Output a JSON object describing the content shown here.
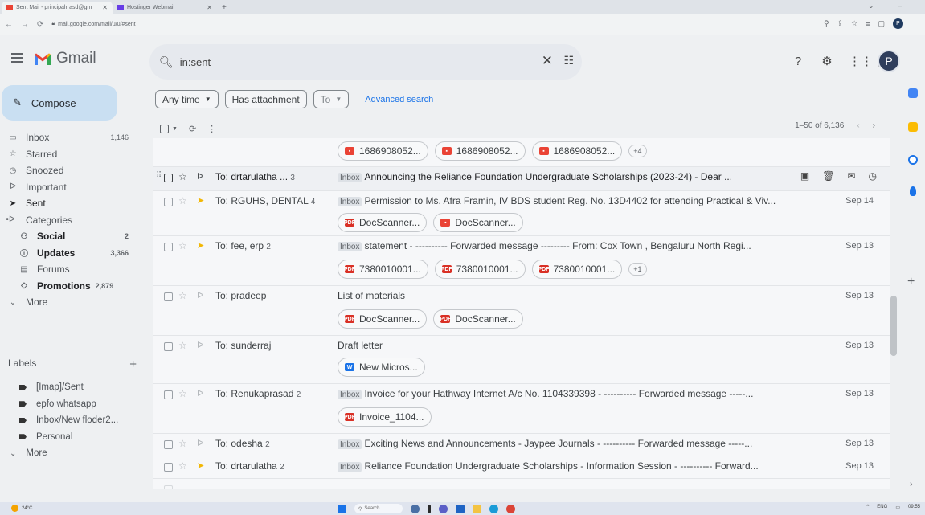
{
  "browser": {
    "tabs": [
      {
        "title": "Sent Mail - principalrrasd@gm",
        "active": true
      },
      {
        "title": "Hostinger Webmail",
        "active": false
      }
    ],
    "url": "mail.google.com/mail/u/0/#sent",
    "profile_initial": "P"
  },
  "header": {
    "logo_text": "Gmail",
    "search_value": "in:sent",
    "avatar_initial": "P"
  },
  "sidebar": {
    "compose_label": "Compose",
    "items": [
      {
        "icon": "inbox-icon",
        "label": "Inbox",
        "count": "1,146"
      },
      {
        "icon": "star-icon",
        "label": "Starred",
        "count": ""
      },
      {
        "icon": "clock-icon",
        "label": "Snoozed",
        "count": ""
      },
      {
        "icon": "important-icon",
        "label": "Important",
        "count": ""
      },
      {
        "icon": "send-icon",
        "label": "Sent",
        "count": ""
      },
      {
        "icon": "category-icon",
        "label": "Categories",
        "count": ""
      },
      {
        "icon": "social-icon",
        "label": "Social",
        "count": "2"
      },
      {
        "icon": "info-icon",
        "label": "Updates",
        "count": "3,366"
      },
      {
        "icon": "forum-icon",
        "label": "Forums",
        "count": ""
      },
      {
        "icon": "tag-icon",
        "label": "Promotions",
        "count": "2,879"
      },
      {
        "icon": "chevron-down-icon",
        "label": "More",
        "count": ""
      }
    ],
    "labels_title": "Labels",
    "labels": [
      "[Imap]/Sent",
      "epfo whatsapp",
      "Inbox/New floder2...",
      "Personal"
    ],
    "labels_more": "More"
  },
  "filters": {
    "any_time": "Any time",
    "has_attachment": "Has attachment",
    "to": "To",
    "advanced": "Advanced search"
  },
  "toolbar": {
    "pager": "1–50 of 6,136"
  },
  "emails": [
    {
      "from": "",
      "count": "",
      "inbox_tag": "",
      "subject": "",
      "date": "",
      "attachments": [
        {
          "type": "img",
          "name": "1686908052..."
        },
        {
          "type": "img",
          "name": "1686908052..."
        },
        {
          "type": "img",
          "name": "1686908052..."
        }
      ],
      "more": "+4"
    },
    {
      "from": "To: drtarulatha ...",
      "count": "3",
      "inbox_tag": "Inbox",
      "subject": "Announcing the Reliance Foundation Undergraduate Scholarships (2023-24) - Dear ...",
      "date": "",
      "attachments": []
    },
    {
      "from": "To: RGUHS, DENTAL",
      "count": "4",
      "inbox_tag": "Inbox",
      "subject": "Permission to Ms. Afra Framin, IV BDS student Reg. No. 13D4402 for attending Practical & Viv...",
      "date": "Sep 14",
      "attachments": [
        {
          "type": "pdf",
          "name": "DocScanner..."
        },
        {
          "type": "img",
          "name": "DocScanner..."
        }
      ]
    },
    {
      "from": "To: fee, erp",
      "count": "2",
      "inbox_tag": "Inbox",
      "subject": "statement - ---------- Forwarded message --------- From: Cox Town , Bengaluru North Regi...",
      "date": "Sep 13",
      "attachments": [
        {
          "type": "pdf",
          "name": "7380010001..."
        },
        {
          "type": "pdf",
          "name": "7380010001..."
        },
        {
          "type": "pdf",
          "name": "7380010001..."
        }
      ],
      "more": "+1"
    },
    {
      "from": "To: pradeep",
      "count": "",
      "inbox_tag": "",
      "subject": "List of materials",
      "date": "Sep 13",
      "attachments": [
        {
          "type": "pdf",
          "name": "DocScanner..."
        },
        {
          "type": "pdf",
          "name": "DocScanner..."
        }
      ]
    },
    {
      "from": "To: sunderraj",
      "count": "",
      "inbox_tag": "",
      "subject": "Draft letter",
      "date": "Sep 13",
      "attachments": [
        {
          "type": "doc",
          "name": "New Micros..."
        }
      ]
    },
    {
      "from": "To: Renukaprasad",
      "count": "2",
      "inbox_tag": "Inbox",
      "subject": "Invoice for your Hathway Internet A/c No. 1104339398 - ---------- Forwarded message -----...",
      "date": "Sep 13",
      "attachments": [
        {
          "type": "pdf",
          "name": "Invoice_1104..."
        }
      ]
    },
    {
      "from": "To: odesha",
      "count": "2",
      "inbox_tag": "Inbox",
      "subject": "Exciting News and Announcements - Jaypee Journals - ---------- Forwarded message -----...",
      "date": "Sep 13",
      "attachments": []
    },
    {
      "from": "To: drtarulatha",
      "count": "2",
      "inbox_tag": "Inbox",
      "subject": "Reliance Foundation Undergraduate Scholarships - Information Session - ---------- Forward...",
      "date": "Sep 13",
      "attachments": []
    }
  ],
  "taskbar": {
    "weather": "24°C",
    "search": "Search",
    "lang": "ENG",
    "time": "09:55"
  }
}
